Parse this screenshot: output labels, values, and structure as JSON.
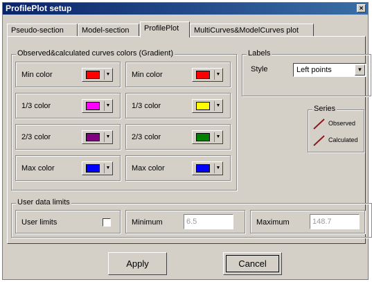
{
  "window": {
    "title": "ProfilePlot setup",
    "close_glyph": "×"
  },
  "tabs": [
    {
      "label": "Pseudo-section"
    },
    {
      "label": "Model-section"
    },
    {
      "label": "ProfilePlot"
    },
    {
      "label": "MultiCurves&ModelCurves plot"
    }
  ],
  "colors_group": {
    "title": "Observed&calculated curves colors (Gradient)",
    "left": [
      {
        "label": "Min color",
        "color": "#ff0000"
      },
      {
        "label": "1/3 color",
        "color": "#ff00ff"
      },
      {
        "label": "2/3 color",
        "color": "#800080"
      },
      {
        "label": "Max color",
        "color": "#0000ff"
      }
    ],
    "right": [
      {
        "label": "Min color",
        "color": "#ff0000"
      },
      {
        "label": "1/3 color",
        "color": "#ffff00"
      },
      {
        "label": "2/3 color",
        "color": "#008000"
      },
      {
        "label": "Max color",
        "color": "#0000ff"
      }
    ],
    "dropdown_glyph": "▼"
  },
  "labels_group": {
    "title": "Labels",
    "style_label": "Style",
    "style_value": "Left points",
    "dropdown_glyph": "▼"
  },
  "series_group": {
    "title": "Series",
    "items": [
      {
        "label": "Observed",
        "color": "#8b1a1a"
      },
      {
        "label": "Calculated",
        "color": "#8b1a1a"
      }
    ]
  },
  "limits_group": {
    "title": "User data limits",
    "user_limits_label": "User limits",
    "user_limits_checked": false,
    "minimum_label": "Minimum",
    "minimum_value": "6.5",
    "maximum_label": "Maximum",
    "maximum_value": "148.7"
  },
  "buttons": {
    "apply": "Apply",
    "cancel": "Cancel"
  }
}
